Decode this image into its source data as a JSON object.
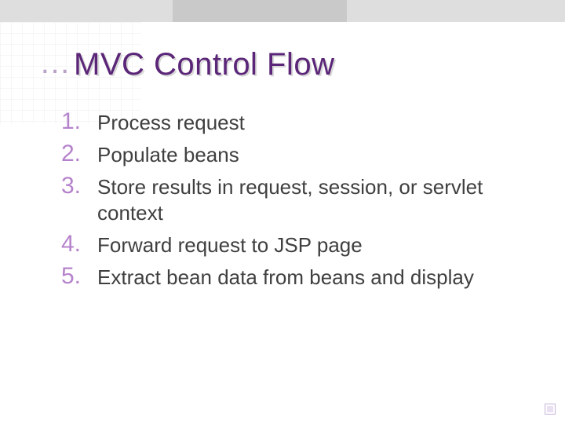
{
  "title": {
    "bullet": "…",
    "text": "MVC Control Flow"
  },
  "items": [
    {
      "n": "1.",
      "text": "Process request"
    },
    {
      "n": "2.",
      "text": "Populate beans"
    },
    {
      "n": "3.",
      "text": "Store results in request, session, or servlet context"
    },
    {
      "n": "4.",
      "text": "Forward request to JSP page"
    },
    {
      "n": "5.",
      "text": "Extract bean data from beans and display"
    }
  ]
}
